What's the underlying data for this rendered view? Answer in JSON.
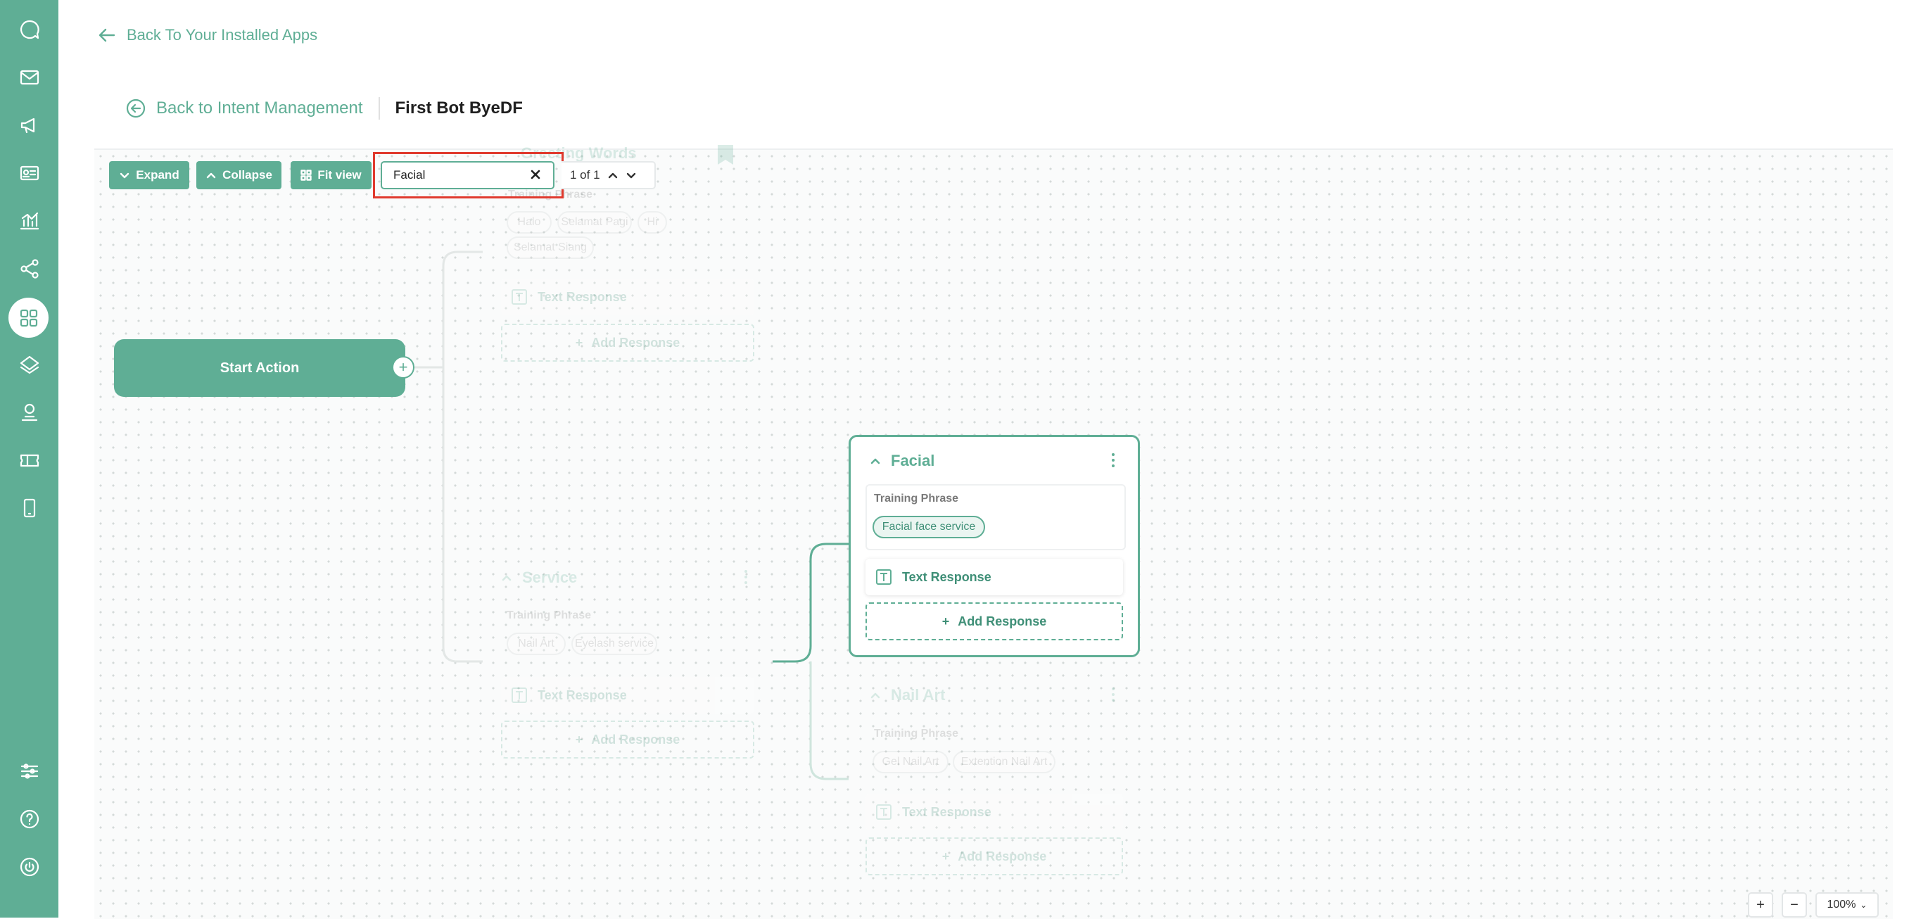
{
  "sidebar": {
    "icons": [
      "chat-bubble-icon",
      "mail-icon",
      "megaphone-icon",
      "contact-card-icon",
      "chart-icon",
      "share-nodes-icon",
      "apps-grid-icon",
      "layers-icon",
      "user-stamp-icon",
      "ticket-icon",
      "mobile-icon",
      "sliders-icon",
      "help-icon",
      "power-icon"
    ],
    "active": "apps-grid-icon"
  },
  "nav": {
    "back_apps": "Back To Your Installed Apps",
    "back_intent": "Back to Intent Management",
    "bot_title": "First Bot ByeDF"
  },
  "toolbar": {
    "expand": "Expand",
    "collapse": "Collapse",
    "fit_view": "Fit view",
    "search_value": "Facial",
    "pager_text": "1 of 1"
  },
  "flow": {
    "start_action": "Start Action",
    "greeting": {
      "title": "Greeting Words",
      "training_label": "Training Phrase",
      "phrases": [
        "Halo",
        "Selamat Pagi",
        "Hi",
        "Selamat Siang"
      ],
      "response": "Text Response",
      "add_response": "Add Response"
    },
    "service": {
      "title": "Service",
      "training_label": "Training Phrase",
      "phrases": [
        "Nail Art",
        "Eyelash service"
      ],
      "response": "Text Response",
      "add_response": "Add Response"
    },
    "facial": {
      "title": "Facial",
      "training_label": "Training Phrase",
      "phrases": [
        "Facial face service"
      ],
      "response": "Text Response",
      "add_response": "Add Response"
    },
    "nail_art": {
      "title": "Nail Art",
      "training_label": "Training Phrase",
      "phrases": [
        "Gel Nail Art",
        "Extention Nail Art"
      ],
      "response": "Text Response",
      "add_response": "Add Response"
    }
  },
  "zoom": {
    "plus": "+",
    "minus": "−",
    "level": "100%"
  },
  "colors": {
    "brand": "#5fae95",
    "highlight": "#e03a2e"
  }
}
